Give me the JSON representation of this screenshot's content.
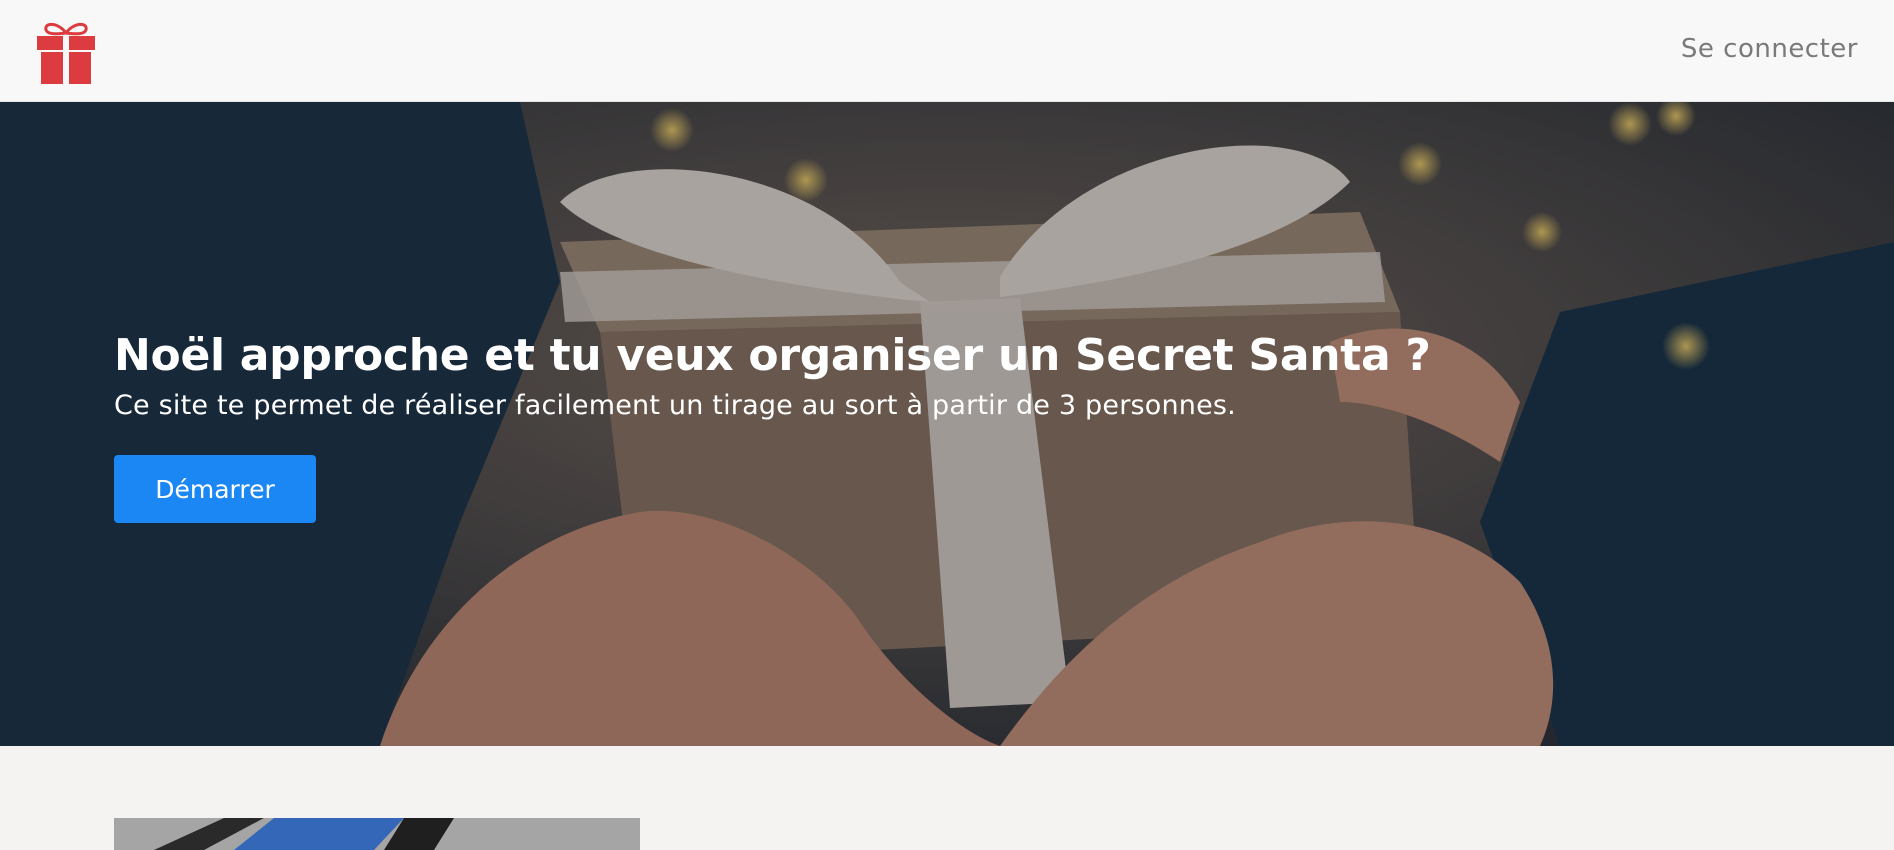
{
  "navbar": {
    "logo_icon": "gift-icon",
    "login_label": "Se connecter"
  },
  "hero": {
    "title": "Noël approche et tu veux organiser un Secret Santa ?",
    "subtitle": "Ce site te permet de réaliser facilement un tirage au sort à partir de 3 personnes.",
    "start_label": "Démarrer",
    "background_icon": "gift-exchange-photo"
  },
  "colors": {
    "accent": "#1a87f5",
    "logo": "#dc3b3f",
    "nav_text": "#7a7a7a"
  }
}
